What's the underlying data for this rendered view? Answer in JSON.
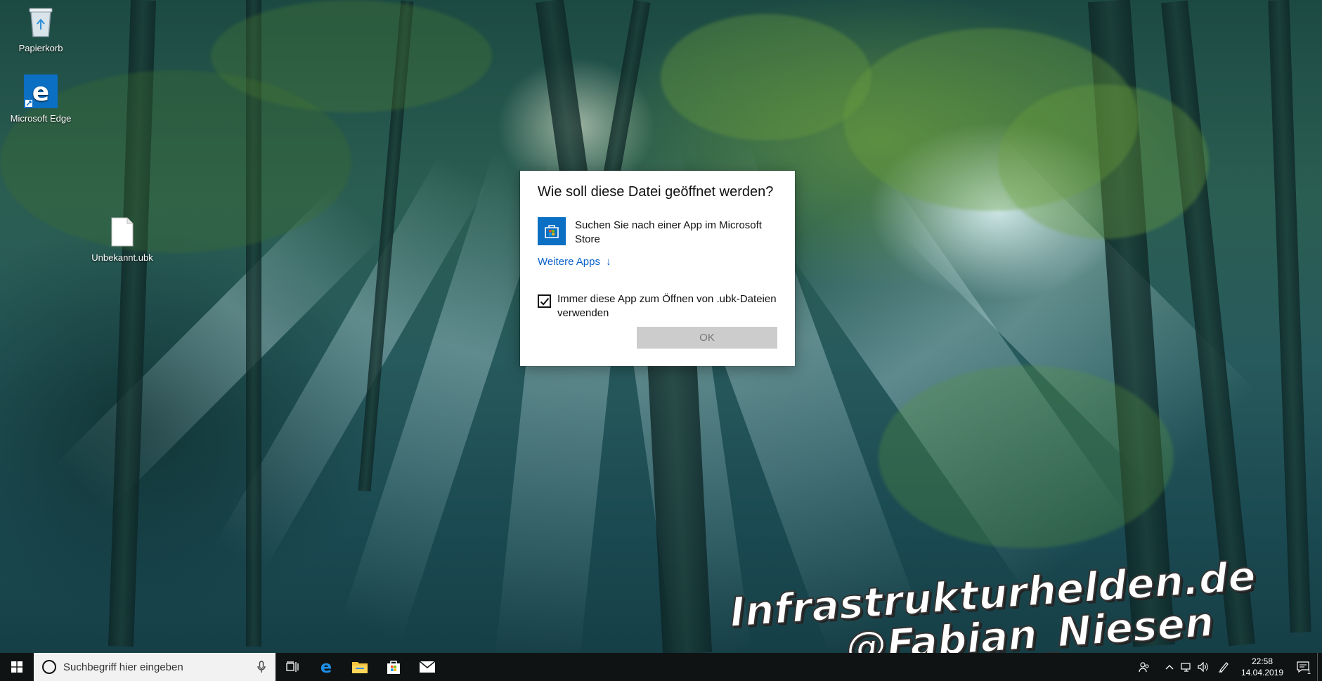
{
  "desktop": {
    "icons": [
      {
        "label": "Papierkorb",
        "icon": "recycle-bin-icon"
      },
      {
        "label": "Microsoft Edge",
        "icon": "edge-icon"
      },
      {
        "label": "Unbekannt.ubk",
        "icon": "file-icon"
      }
    ],
    "watermark": {
      "line1": "Infrastrukturhelden.de",
      "line2": "@Fabian_Niesen"
    }
  },
  "dialog": {
    "title": "Wie soll diese Datei geöffnet werden?",
    "store_option": "Suchen Sie nach einer App im Microsoft Store",
    "more_apps": "Weitere Apps",
    "more_apps_arrow": "↓",
    "always_use": "Immer diese App zum Öffnen von .ubk-Dateien verwenden",
    "always_use_checked": true,
    "ok_label": "OK"
  },
  "taskbar": {
    "search_placeholder": "Suchbegriff hier eingeben",
    "pinned": [
      "task-view-icon",
      "edge-icon",
      "file-explorer-icon",
      "store-icon",
      "mail-icon"
    ],
    "clock_time": "22:58",
    "clock_date": "14.04.2019",
    "notification_count": "1"
  },
  "colors": {
    "accent": "#0b6fc4",
    "link": "#0a62c9",
    "taskbar": "#101314"
  }
}
